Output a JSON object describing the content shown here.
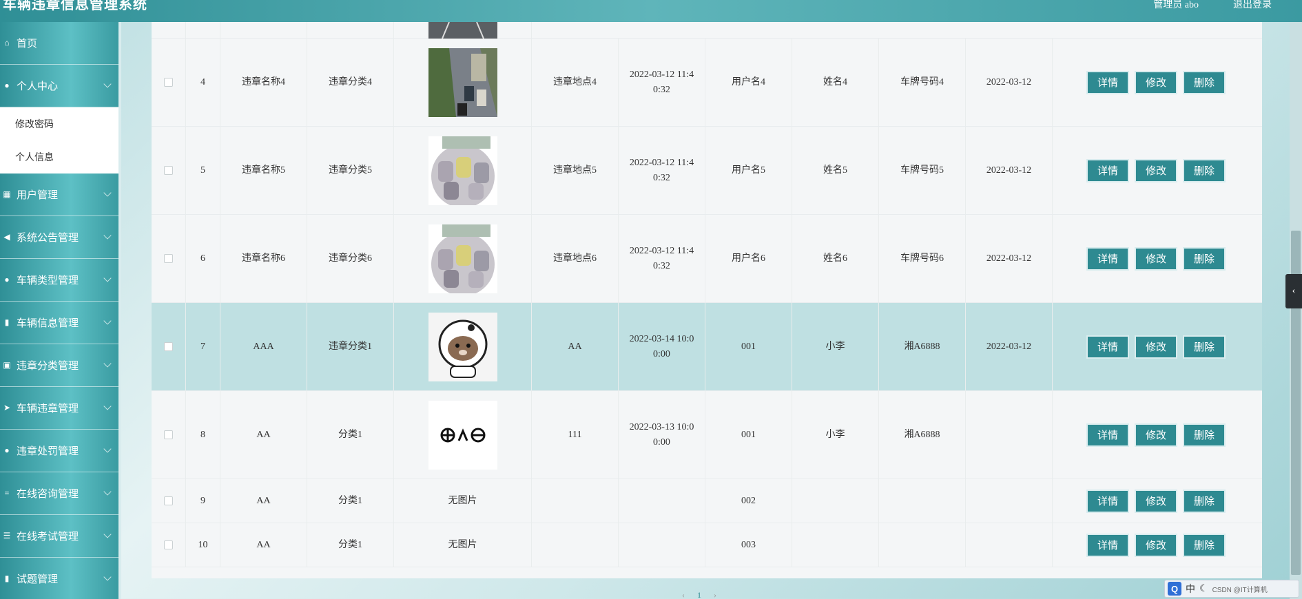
{
  "header": {
    "title": "车辆违章信息管理系统",
    "admin_label": "管理员 abo",
    "logout_label": "退出登录"
  },
  "sidebar": {
    "items": [
      {
        "label": "首页",
        "icon": "home-icon"
      },
      {
        "label": "个人中心",
        "icon": "user-icon"
      },
      {
        "label": "用户管理",
        "icon": "grid-icon"
      },
      {
        "label": "系统公告管理",
        "icon": "bullhorn-icon"
      },
      {
        "label": "车辆类型管理",
        "icon": "pin-icon"
      },
      {
        "label": "车辆信息管理",
        "icon": "bar-chart-icon"
      },
      {
        "label": "违章分类管理",
        "icon": "clipboard-icon"
      },
      {
        "label": "车辆违章管理",
        "icon": "send-icon"
      },
      {
        "label": "违章处罚管理",
        "icon": "user-icon"
      },
      {
        "label": "在线咨询管理",
        "icon": "sliders-icon"
      },
      {
        "label": "在线考试管理",
        "icon": "list-icon"
      },
      {
        "label": "试题管理",
        "icon": "bar-chart-icon"
      }
    ],
    "submenu": [
      "修改密码",
      "个人信息"
    ]
  },
  "table": {
    "no_image_label": "无图片",
    "buttons": {
      "detail": "详情",
      "edit": "修改",
      "delete": "删除"
    },
    "rows": [
      {
        "no": "4",
        "name": "违章名称4",
        "category": "违章分类4",
        "image": "traffic",
        "place": "违章地点4",
        "time_a": "2022-03-12 11:4",
        "time_b": "0:32",
        "user": "用户名4",
        "real_name": "姓名4",
        "plate": "车牌号码4",
        "date": "2022-03-12"
      },
      {
        "no": "5",
        "name": "违章名称5",
        "category": "违章分类5",
        "image": "cars",
        "place": "违章地点5",
        "time_a": "2022-03-12 11:4",
        "time_b": "0:32",
        "user": "用户名5",
        "real_name": "姓名5",
        "plate": "车牌号码5",
        "date": "2022-03-12"
      },
      {
        "no": "6",
        "name": "违章名称6",
        "category": "违章分类6",
        "image": "cars",
        "place": "违章地点6",
        "time_a": "2022-03-12 11:4",
        "time_b": "0:32",
        "user": "用户名6",
        "real_name": "姓名6",
        "plate": "车牌号码6",
        "date": "2022-03-12"
      },
      {
        "no": "7",
        "name": "AAA",
        "category": "违章分类1",
        "image": "astronaut",
        "place": "AA",
        "time_a": "2022-03-14 10:0",
        "time_b": "0:00",
        "user": "001",
        "real_name": "小李",
        "plate": "湘A6888",
        "date": "2022-03-12"
      },
      {
        "no": "8",
        "name": "AA",
        "category": "分类1",
        "image": "emoticon",
        "place": "111",
        "time_a": "2022-03-13 10:0",
        "time_b": "0:00",
        "user": "001",
        "real_name": "小李",
        "plate": "湘A6888",
        "date": ""
      },
      {
        "no": "9",
        "name": "AA",
        "category": "分类1",
        "image": "none",
        "place": "",
        "time_a": "",
        "time_b": "",
        "user": "002",
        "real_name": "",
        "plate": "",
        "date": ""
      },
      {
        "no": "10",
        "name": "AA",
        "category": "分类1",
        "image": "none",
        "place": "",
        "time_a": "",
        "time_b": "",
        "user": "003",
        "real_name": "",
        "plate": "",
        "date": ""
      }
    ]
  },
  "pagination": {
    "prev": "‹",
    "current": "1",
    "next": "›"
  },
  "ime": {
    "q_label": "Q",
    "mode": "中",
    "extra": "CSDN @IT计算机"
  },
  "colors": {
    "accent": "#2e8a91",
    "highlight_row": "#bfe0e2"
  }
}
